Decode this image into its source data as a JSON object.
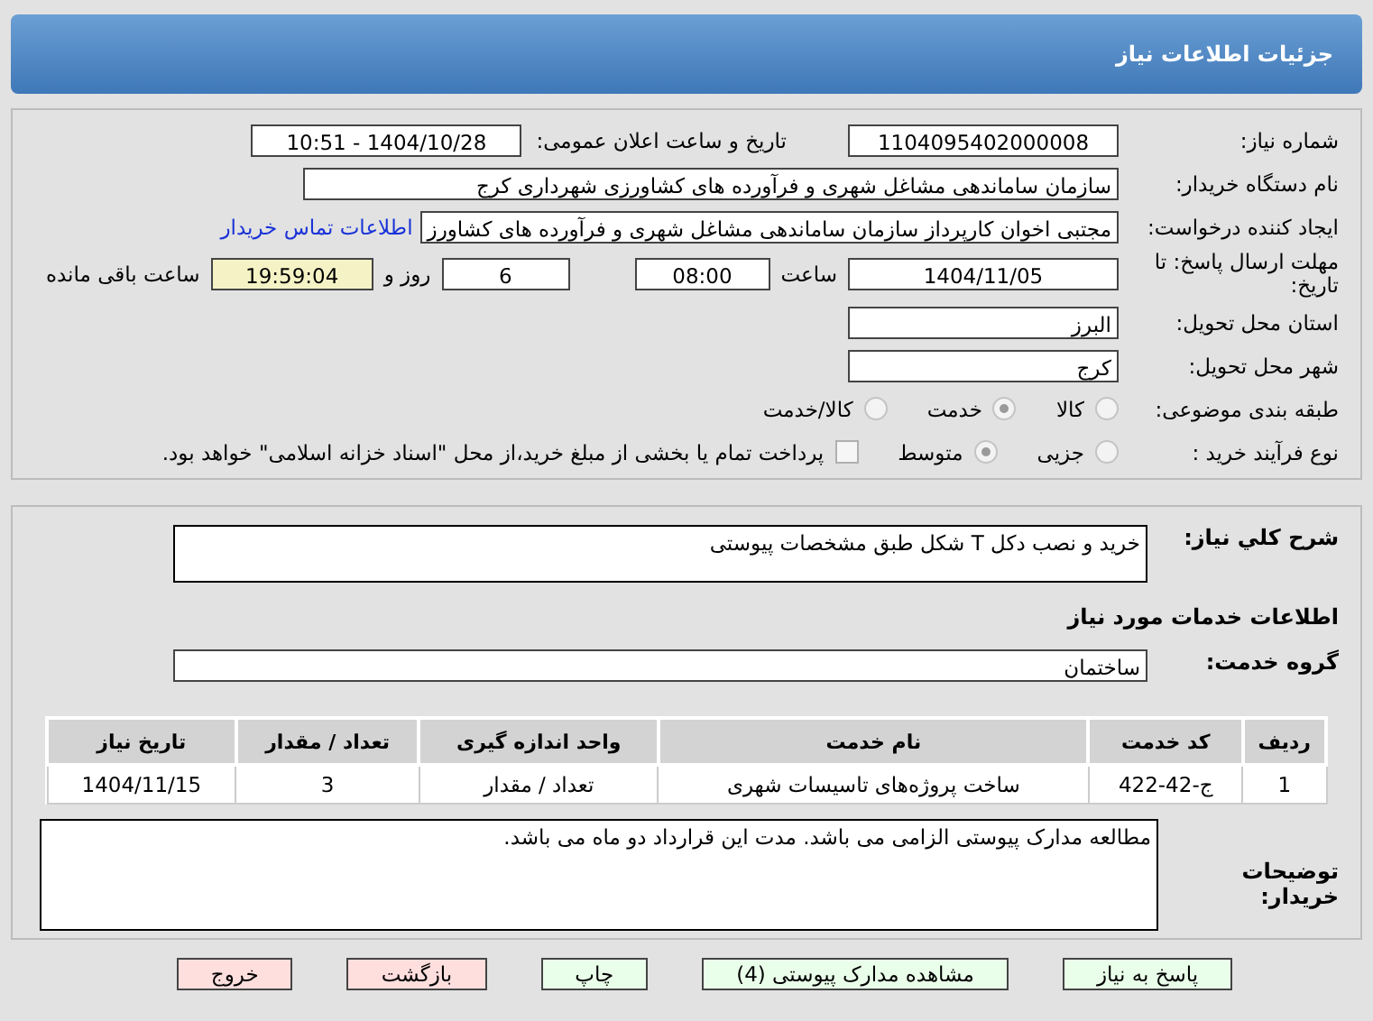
{
  "title": "جزئیات اطلاعات نیاز",
  "need_number": {
    "label": "شماره نیاز:",
    "value": "1104095402000008"
  },
  "announce": {
    "label": "تاریخ و ساعت اعلان عمومی:",
    "value": "1404/10/28 - 10:51"
  },
  "buyer": {
    "label": "نام دستگاه خریدار:",
    "value": "سازمان ساماندهی مشاغل شهری و فرآورده های کشاورزی شهرداری کرج"
  },
  "creator": {
    "label": "ایجاد کننده درخواست:",
    "value": "مجتبی اخوان کارپرداز سازمان ساماندهی مشاغل شهری و فرآورده های کشاورز",
    "link": "اطلاعات تماس خریدار"
  },
  "deadline": {
    "label": "مهلت ارسال پاسخ: تا تاریخ:",
    "date": "1404/11/05",
    "time_label": "ساعت",
    "time": "08:00",
    "days": "6",
    "days_label": "روز و",
    "remaining": "19:59:04",
    "remaining_label": "ساعت باقی مانده"
  },
  "province": {
    "label": "استان محل تحویل:",
    "value": "البرز"
  },
  "city": {
    "label": "شهر محل تحویل:",
    "value": "کرج"
  },
  "category": {
    "label": "طبقه بندی موضوعی:",
    "options": [
      {
        "label": "کالا",
        "selected": false
      },
      {
        "label": "خدمت",
        "selected": true
      },
      {
        "label": "کالا/خدمت",
        "selected": false
      }
    ]
  },
  "purchase_type": {
    "label": "نوع فرآیند خرید :",
    "options": [
      {
        "label": "جزیی",
        "selected": false
      },
      {
        "label": "متوسط",
        "selected": true
      }
    ],
    "checkbox": {
      "label": "پرداخت تمام یا بخشی از مبلغ خرید،از محل \"اسناد خزانه اسلامی\" خواهد بود.",
      "checked": false
    }
  },
  "description": {
    "label": "شرح کلي نياز:",
    "value": "خرید و نصب دکل T شکل طبق مشخصات پیوستی"
  },
  "services_heading": "اطلاعات خدمات مورد نياز",
  "service_group": {
    "label": "گروه خدمت:",
    "value": "ساختمان"
  },
  "table": {
    "columns": [
      "ردیف",
      "کد خدمت",
      "نام خدمت",
      "واحد اندازه گیری",
      "تعداد / مقدار",
      "تاریخ نیاز"
    ],
    "rows": [
      [
        "1",
        "ج-42-422",
        "ساخت پروژه‌های تاسیسات شهری",
        "تعداد / مقدار",
        "3",
        "1404/11/15"
      ]
    ]
  },
  "buyer_notes": {
    "label": "توضیحات خریدار:",
    "value": "مطالعه مدارک پیوستی الزامی می باشد. مدت این قرارداد دو ماه می باشد."
  },
  "buttons": [
    {
      "label": "پاسخ به نیاز",
      "kind": "normal"
    },
    {
      "label": "مشاهده مدارک پیوستی (4)",
      "kind": "normal"
    },
    {
      "label": "چاپ",
      "kind": "normal"
    },
    {
      "label": "بازگشت",
      "kind": "danger"
    },
    {
      "label": "خروج",
      "kind": "danger"
    }
  ]
}
